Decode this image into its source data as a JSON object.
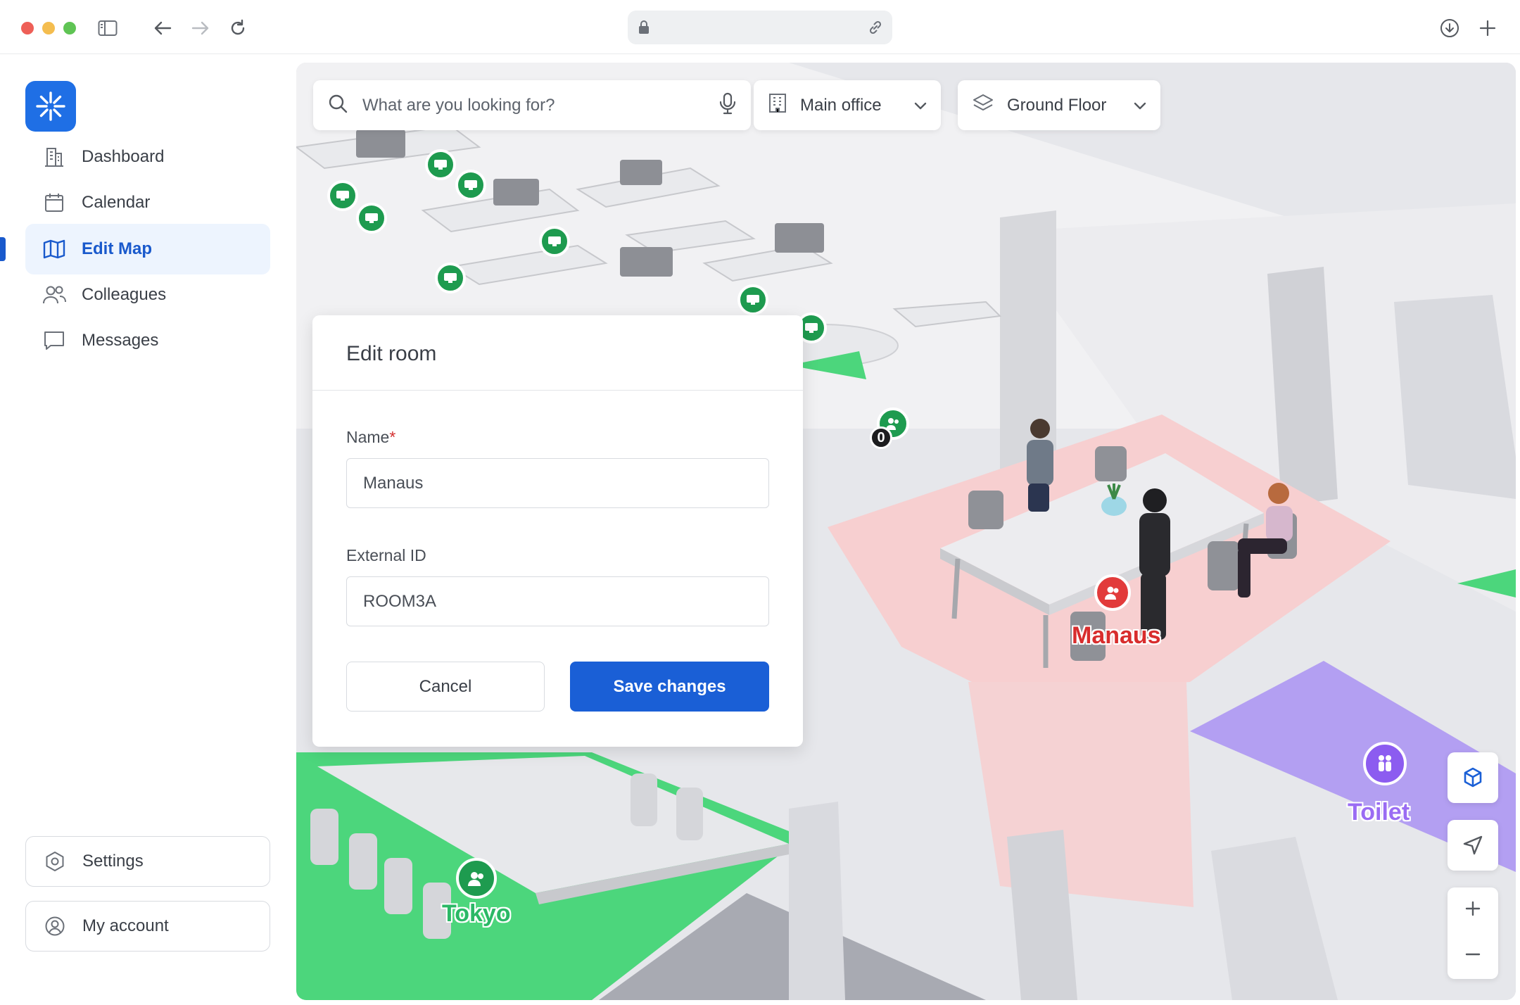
{
  "browser": {
    "address": ""
  },
  "sidebar": {
    "items": [
      {
        "label": "Dashboard",
        "icon": "building-icon",
        "active": false
      },
      {
        "label": "Calendar",
        "icon": "calendar-icon",
        "active": false
      },
      {
        "label": "Edit Map",
        "icon": "map-icon",
        "active": true
      },
      {
        "label": "Colleagues",
        "icon": "people-icon",
        "active": false
      },
      {
        "label": "Messages",
        "icon": "message-icon",
        "active": false
      }
    ],
    "settings_label": "Settings",
    "account_label": "My account"
  },
  "map": {
    "search": {
      "placeholder": "What are you looking for?"
    },
    "office_select": {
      "value": "Main office"
    },
    "floor_select": {
      "value": "Ground Floor"
    },
    "labels": {
      "manaus": "Manaus",
      "tokyo": "Tokyo",
      "toilet": "Toilet"
    },
    "badge_count": "0",
    "colors": {
      "desk_marker": "#1e9b4f",
      "room_marker_selected": "#e23b3b",
      "room_green": "#4ad67e",
      "room_pink": "#f6d0d0",
      "toilet_purple": "#b4a0f0",
      "accent": "#1a5fd6"
    }
  },
  "modal": {
    "title": "Edit room",
    "name_label": "Name",
    "name_required_mark": "*",
    "name_value": "Manaus",
    "external_id_label": "External ID",
    "external_id_value": "ROOM3A",
    "cancel_label": "Cancel",
    "save_label": "Save changes"
  }
}
